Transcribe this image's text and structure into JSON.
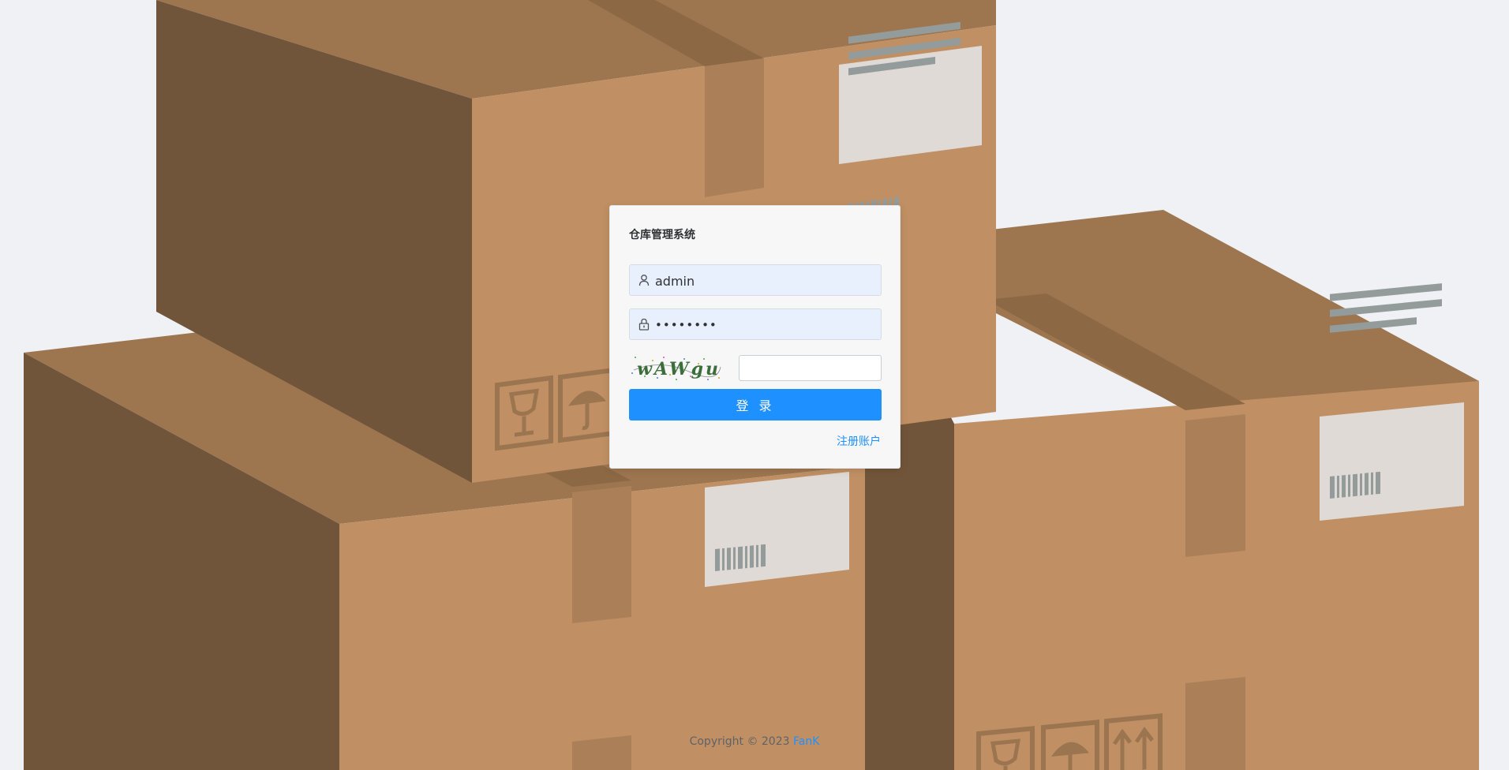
{
  "login": {
    "title": "仓库管理系统",
    "username_value": "admin",
    "password_value": "••••••••",
    "captcha_text": "wAWgu",
    "captcha_input_value": "",
    "login_label": "登 录",
    "register_label": "注册账户"
  },
  "footer": {
    "copyright_text": "Copyright © 2023",
    "author": "FanK"
  },
  "colors": {
    "accent": "#1e90ff",
    "background": "#eff1f5",
    "box_face": "#c09064",
    "box_top": "#9d7650",
    "box_side": "#71553a"
  },
  "icons": {
    "username": "user-icon",
    "password": "lock-icon"
  }
}
